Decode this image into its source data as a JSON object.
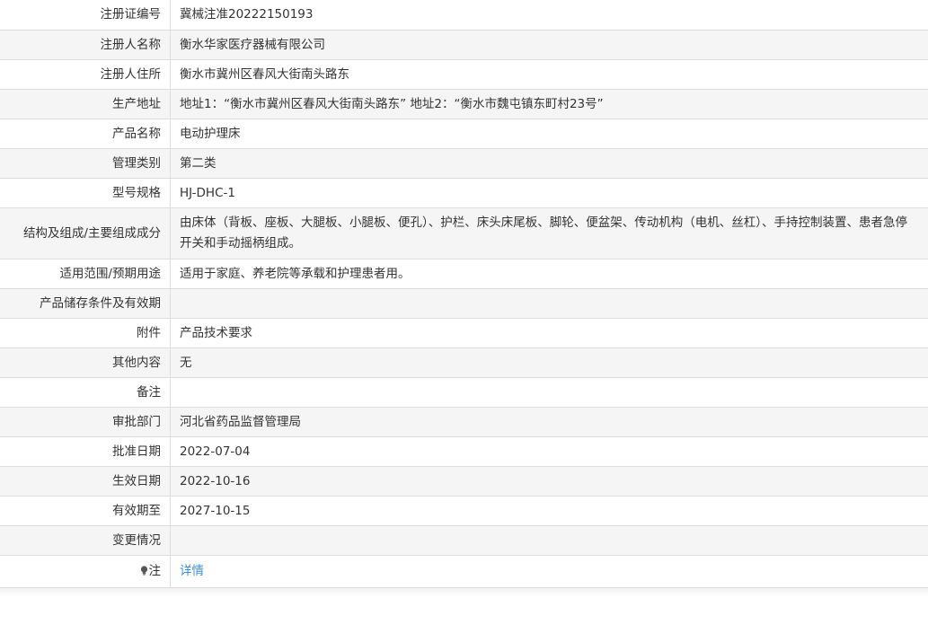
{
  "rows": [
    {
      "label": "注册证编号",
      "value": "冀械注准20222150193"
    },
    {
      "label": "注册人名称",
      "value": "衡水华家医疗器械有限公司"
    },
    {
      "label": "注册人住所",
      "value": "衡水市冀州区春风大街南头路东"
    },
    {
      "label": "生产地址",
      "value": "地址1：“衡水市冀州区春风大街南头路东” 地址2：“衡水市魏屯镇东町村23号”"
    },
    {
      "label": "产品名称",
      "value": "电动护理床"
    },
    {
      "label": "管理类别",
      "value": "第二类"
    },
    {
      "label": "型号规格",
      "value": "HJ-DHC-1"
    },
    {
      "label": "结构及组成/主要组成成分",
      "value": "由床体（背板、座板、大腿板、小腿板、便孔）、护栏、床头床尾板、脚轮、便盆架、传动机构（电机、丝杠）、手持控制装置、患者急停开关和手动摇柄组成。"
    },
    {
      "label": "适用范围/预期用途",
      "value": "适用于家庭、养老院等承载和护理患者用。"
    },
    {
      "label": "产品储存条件及有效期",
      "value": ""
    },
    {
      "label": "附件",
      "value": "产品技术要求"
    },
    {
      "label": "其他内容",
      "value": "无"
    },
    {
      "label": "备注",
      "value": ""
    },
    {
      "label": "审批部门",
      "value": "河北省药品监督管理局"
    },
    {
      "label": "批准日期",
      "value": "2022-07-04"
    },
    {
      "label": "生效日期",
      "value": "2022-10-16"
    },
    {
      "label": "有效期至",
      "value": "2027-10-15"
    },
    {
      "label": "变更情况",
      "value": ""
    }
  ],
  "note": {
    "icon": "bulb-icon",
    "label": "注",
    "link_text": "详情",
    "link_color": "#3c8dcd"
  },
  "colors": {
    "row_shade": "#f5f5f5",
    "border": "#dddddd",
    "text": "#333333"
  }
}
